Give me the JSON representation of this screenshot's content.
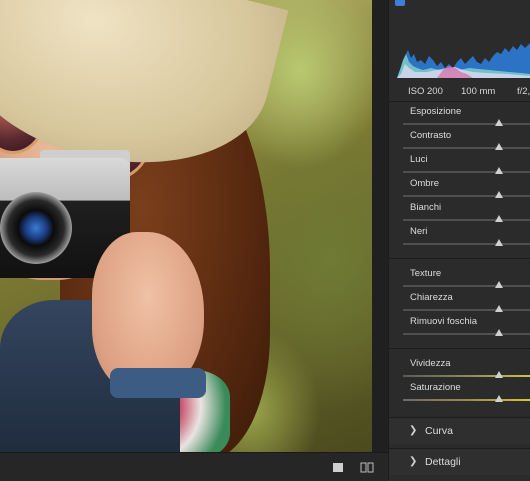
{
  "camera_info": {
    "iso": "ISO 200",
    "focal_length": "100 mm",
    "aperture": "f/2,"
  },
  "basic_sliders": [
    {
      "label": "Esposizione",
      "value": 0.75
    },
    {
      "label": "Contrasto",
      "value": 0.75
    },
    {
      "label": "Luci",
      "value": 0.75
    },
    {
      "label": "Ombre",
      "value": 0.75
    },
    {
      "label": "Bianchi",
      "value": 0.75
    },
    {
      "label": "Neri",
      "value": 0.75
    }
  ],
  "presence_sliders": [
    {
      "label": "Texture",
      "value": 0.75
    },
    {
      "label": "Chiarezza",
      "value": 0.75
    },
    {
      "label": "Rimuovi foschia",
      "value": 0.75
    }
  ],
  "color_sliders": [
    {
      "label": "Vividezza",
      "value": 0.75
    },
    {
      "label": "Saturazione",
      "value": 0.75
    }
  ],
  "sections": [
    {
      "title": "Curva",
      "expanded": false
    },
    {
      "title": "Dettagli",
      "expanded": false
    }
  ],
  "icons": {
    "panel_top": "panel-top-icon",
    "single_view": "single-view-icon",
    "compare_view": "compare-view-icon",
    "chevron": "chevron-right-icon"
  },
  "colors": {
    "accent": "#3c7fd9",
    "panel_bg": "#2b2b2b",
    "text": "#dcdcdc"
  }
}
